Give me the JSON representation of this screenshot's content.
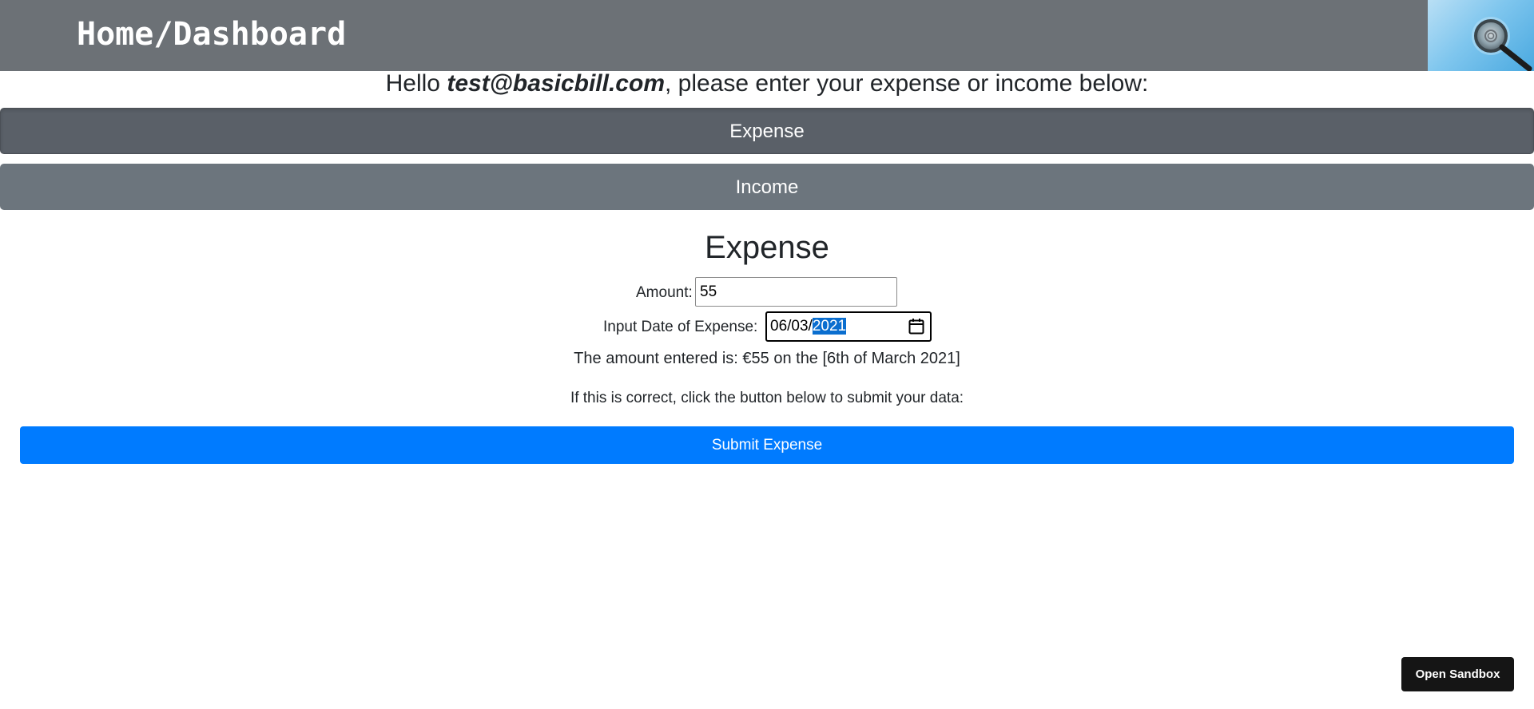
{
  "header": {
    "title": "Home/Dashboard",
    "logo_icon": "magnifier-fingerprint-icon"
  },
  "greeting": {
    "prefix": "Hello ",
    "email": "test@basicbill.com",
    "suffix": ", please enter your expense or income below:"
  },
  "tabs": {
    "expense_label": "Expense",
    "income_label": "Income"
  },
  "form": {
    "section_title": "Expense",
    "amount_label": "Amount:",
    "amount_value": "55",
    "date_label": "Input Date of Expense:",
    "date_day_month": "06/03/",
    "date_year_selected": "2021",
    "calendar_icon": "calendar-icon"
  },
  "summary": "The amount entered is: €55 on the [6th of March 2021]",
  "instructions": "If this is correct, click the button below to submit your data:",
  "submit_label": "Submit Expense",
  "sandbox_label": "Open Sandbox",
  "colors": {
    "header_bg": "#6c7176",
    "active_tab": "#5a6068",
    "tab": "#6c757d",
    "primary": "#007bff",
    "sandbox_bg": "#151515"
  }
}
